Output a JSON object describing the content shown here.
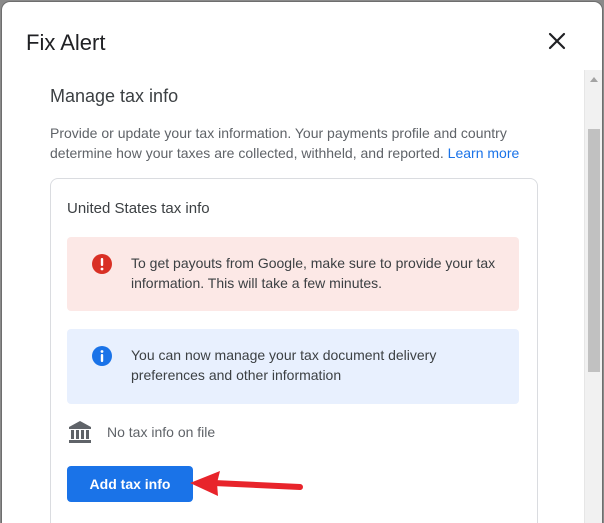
{
  "dialog": {
    "title": "Fix Alert",
    "close_icon": "close-icon"
  },
  "section": {
    "title": "Manage tax info",
    "description": "Provide or update your tax information. Your payments profile and country determine how your taxes are collected, withheld, and reported.",
    "learn_more": "Learn more"
  },
  "card": {
    "title": "United States tax info",
    "error_alert": {
      "icon": "error-icon",
      "text": "To get payouts from Google, make sure to provide your tax information. This will take a few minutes."
    },
    "info_alert": {
      "icon": "info-icon",
      "text": "You can now manage your tax document delivery preferences and other information"
    },
    "status": {
      "icon": "bank-icon",
      "text": "No tax info on file"
    },
    "add_button": "Add tax info"
  },
  "colors": {
    "primary": "#1a73e8",
    "error_bg": "#fce8e6",
    "error_icon": "#d93025",
    "info_bg": "#e8f0fe",
    "annotation_arrow": "#e8242b"
  }
}
